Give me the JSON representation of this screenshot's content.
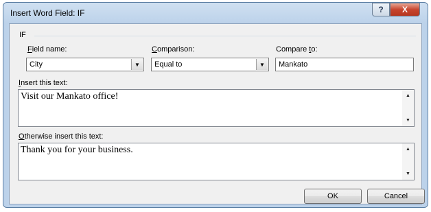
{
  "window": {
    "title": "Insert Word Field: IF",
    "help_glyph": "?",
    "close_glyph": "X"
  },
  "group": {
    "label": "IF"
  },
  "field_name": {
    "label_mnemonic": "F",
    "label_rest": "ield name:",
    "value": "City"
  },
  "comparison": {
    "label_mnemonic": "C",
    "label_rest": "omparison:",
    "value": "Equal to"
  },
  "compare_to": {
    "label_prefix": "Compare ",
    "label_mnemonic": "t",
    "label_rest": "o:",
    "value": "Mankato"
  },
  "insert_text": {
    "label_mnemonic": "I",
    "label_rest": "nsert this text:",
    "value": "Visit our Mankato office!"
  },
  "otherwise_text": {
    "label_mnemonic": "O",
    "label_rest": "therwise insert this text:",
    "value": "Thank you for your business."
  },
  "buttons": {
    "ok": "OK",
    "cancel": "Cancel"
  },
  "icons": {
    "dropdown": "▼",
    "scroll_up": "▲",
    "scroll_down": "▼"
  }
}
